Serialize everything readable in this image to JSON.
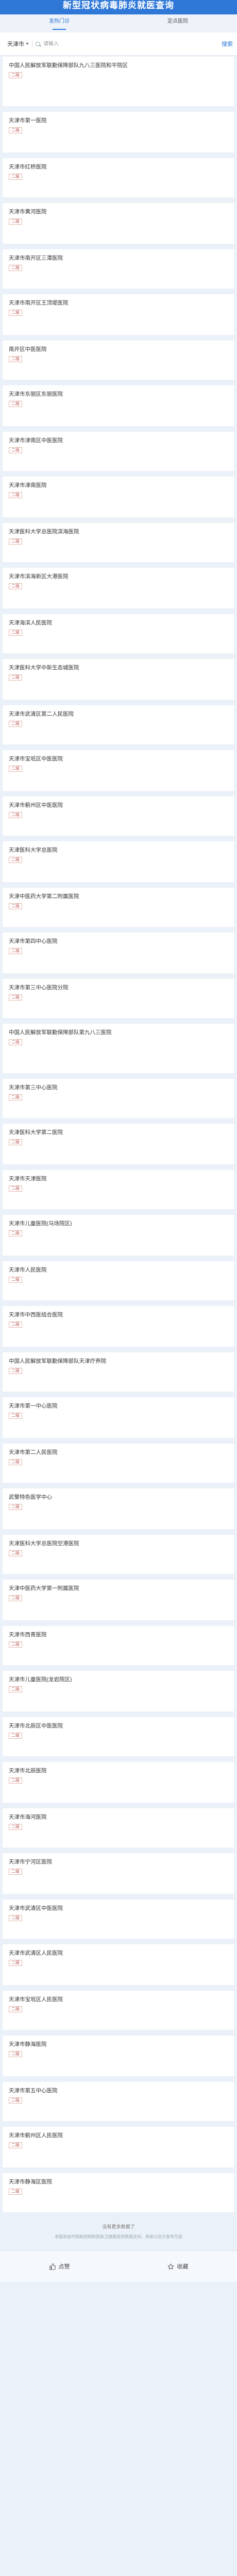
{
  "header": {
    "title": "新型冠状病毒肺炎就医查询",
    "tabs": [
      "发热门诊",
      "定点医院"
    ]
  },
  "search": {
    "city": "天津市",
    "placeholder": "请输入",
    "button": "搜索"
  },
  "hospitals": [
    {
      "name": "中国人民解放军联勤保障部队九八三医院和平院区",
      "tag": "二级"
    },
    {
      "name": "天津市第一医院",
      "tag": "二级"
    },
    {
      "name": "天津市红桥医院",
      "tag": "二级"
    },
    {
      "name": "天津市黄河医院",
      "tag": "二级"
    },
    {
      "name": "天津市南开区三潭医院",
      "tag": "二级"
    },
    {
      "name": "天津市南开区王顶堤医院",
      "tag": "二级"
    },
    {
      "name": "南开区中医医院",
      "tag": "二级"
    },
    {
      "name": "天津市东丽区东丽医院",
      "tag": "二级"
    },
    {
      "name": "天津市津南区中医医院",
      "tag": "二级"
    },
    {
      "name": "天津市津南医院",
      "tag": "二级"
    },
    {
      "name": "天津医科大学总医院滨海医院",
      "tag": "二级"
    },
    {
      "name": "天津市滨海新区大港医院",
      "tag": "二级"
    },
    {
      "name": "天津海滨人民医院",
      "tag": "二级"
    },
    {
      "name": "天津医科大学中新生态城医院",
      "tag": "二级"
    },
    {
      "name": "天津市武清区第二人民医院",
      "tag": "二级"
    },
    {
      "name": "天津市宝坻区中医医院",
      "tag": "二级"
    },
    {
      "name": "天津市蓟州区中医医院",
      "tag": "二级"
    },
    {
      "name": "天津医科大学总医院",
      "tag": "二级"
    },
    {
      "name": "天津中医药大学第二附属医院",
      "tag": "二级"
    },
    {
      "name": "天津市第四中心医院",
      "tag": "二级"
    },
    {
      "name": "天津市第三中心医院分院",
      "tag": "二级"
    },
    {
      "name": "中国人民解放军联勤保障部队第九八三医院",
      "tag": "二级"
    },
    {
      "name": "天津市第三中心医院",
      "tag": "二级"
    },
    {
      "name": "天津医科大学第二医院",
      "tag": "二级"
    },
    {
      "name": "天津市天津医院",
      "tag": "二级"
    },
    {
      "name": "天津市儿童医院(马场院区)",
      "tag": "二级"
    },
    {
      "name": "天津市人民医院",
      "tag": "二级"
    },
    {
      "name": "天津市中西医结合医院",
      "tag": "二级"
    },
    {
      "name": "中国人民解放军联勤保障部队天津疗养院",
      "tag": "二级"
    },
    {
      "name": "天津市第一中心医院",
      "tag": "二级"
    },
    {
      "name": "天津市第二人民医院",
      "tag": "二级"
    },
    {
      "name": "武警特色医学中心",
      "tag": "二级"
    },
    {
      "name": "天津医科大学总医院空港医院",
      "tag": "二级"
    },
    {
      "name": "天津中医药大学第一附属医院",
      "tag": "二级"
    },
    {
      "name": "天津市西青医院",
      "tag": "二级"
    },
    {
      "name": "天津市儿童医院(龙岩院区)",
      "tag": "二级"
    },
    {
      "name": "天津市北辰区中医医院",
      "tag": "二级"
    },
    {
      "name": "天津市北辰医院",
      "tag": "二级"
    },
    {
      "name": "天津市海河医院",
      "tag": "二级"
    },
    {
      "name": "天津市宁河区医院",
      "tag": "二级"
    },
    {
      "name": "天津市武清区中医医院",
      "tag": "二级"
    },
    {
      "name": "天津市武清区人民医院",
      "tag": "二级"
    },
    {
      "name": "天津市宝坻区人民医院",
      "tag": "二级"
    },
    {
      "name": "天津市静海医院",
      "tag": "二级"
    },
    {
      "name": "天津市第五中心医院",
      "tag": "二级"
    },
    {
      "name": "天津市蓟州区人民医院",
      "tag": "二级"
    },
    {
      "name": "天津市静海区医院",
      "tag": "二级"
    }
  ],
  "footer": {
    "more": "没有更多数据了",
    "note": "本服务由中国政府网和国家卫健委提供数据支持，具体以官方发布为准"
  },
  "bottombar": {
    "like": "点赞",
    "favorite": "收藏"
  }
}
